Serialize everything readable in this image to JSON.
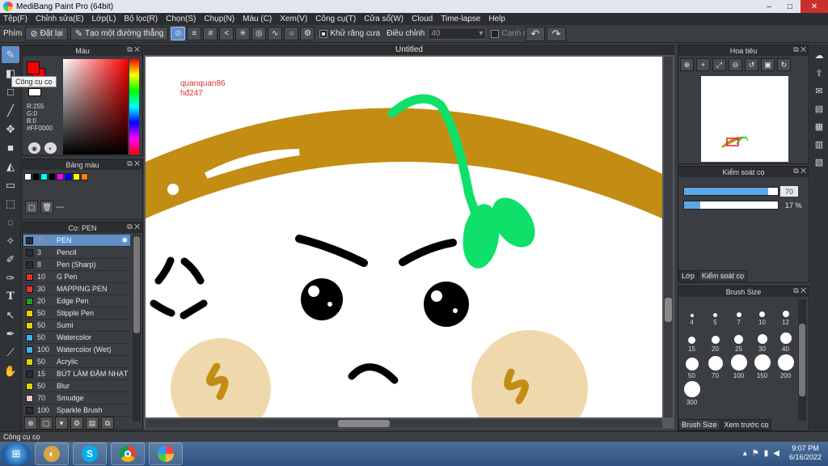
{
  "window": {
    "title": "MediBang Paint Pro (64bit)",
    "minimize": "–",
    "maximize": "□",
    "close": "✕"
  },
  "menu": [
    "Tệp(F)",
    "Chỉnh sửa(E)",
    "Lớp(L)",
    "Bộ lọc(R)",
    "Chọn(S)",
    "Chụp(N)",
    "Màu (C)",
    "Xem(V)",
    "Công cụ(T)",
    "Cửa sổ(W)",
    "Cloud",
    "Time-lapse",
    "Help"
  ],
  "options": {
    "label": "Phím",
    "reset": "Đặt lại",
    "straight_line": "Tạo một đường thẳng",
    "antialias": "Khử răng cưa",
    "adjust": "Điều chỉnh",
    "adjust_value": "40",
    "edge": "Cạnh mềm"
  },
  "tooltip": "Công cụ cọ",
  "color_panel": {
    "title": "Màu",
    "r": "R:255",
    "g": "G:0",
    "b": "B:0",
    "hex": "#FF0000"
  },
  "palette_panel": {
    "title": "Bảng màu",
    "colors": [
      "#ffffff",
      "#000000",
      "#00ffff",
      "#000000",
      "#ff00ff",
      "#0000ff",
      "#ffff00",
      "#ff8000"
    ],
    "dash": "---"
  },
  "brush_panel": {
    "title": "Cọ: PEN",
    "items": [
      {
        "color": "#2a2d33",
        "size": "70",
        "name": "PEN",
        "selected": true
      },
      {
        "color": "#2a2d33",
        "size": "3",
        "name": "Pencil"
      },
      {
        "color": "#2a2d33",
        "size": "8",
        "name": "Pen (Sharp)"
      },
      {
        "color": "#e53030",
        "size": "10",
        "name": "G Pen"
      },
      {
        "color": "#e53030",
        "size": "30",
        "name": "MAPPING PEN"
      },
      {
        "color": "#1fa01f",
        "size": "20",
        "name": "Edge Pen"
      },
      {
        "color": "#e8d100",
        "size": "50",
        "name": "Stipple Pen"
      },
      {
        "color": "#e8d100",
        "size": "50",
        "name": "Sumi"
      },
      {
        "color": "#3fb3e8",
        "size": "50",
        "name": "Watercolor"
      },
      {
        "color": "#3fb3e8",
        "size": "100",
        "name": "Watercolor (Wet)"
      },
      {
        "color": "#e8d100",
        "size": "50",
        "name": "Acrylic"
      },
      {
        "color": "#2a2d33",
        "size": "15",
        "name": "BÚT LÀM ĐẬM NHẠT"
      },
      {
        "color": "#e8d100",
        "size": "50",
        "name": "Blur"
      },
      {
        "color": "#f3c9c0",
        "size": "70",
        "name": "Smudge"
      },
      {
        "color": "#2a2d33",
        "size": "100",
        "name": "Sparkle Brush"
      }
    ]
  },
  "canvas": {
    "tab_title": "Untitled",
    "signature_line1": "quanquan86",
    "signature_line2": "hđ247"
  },
  "navigator": {
    "title": "Hoa tiêu"
  },
  "brush_control": {
    "title": "Kiểm soát cọ",
    "size_value": "70",
    "size_fraction": 0.9,
    "opacity_value": "17 %",
    "opacity_fraction": 0.17,
    "tab_layer": "Lớp",
    "tab_control": "Kiểm soát cọ"
  },
  "brush_size": {
    "title": "Brush Size",
    "sizes": [
      "4",
      "5",
      "7",
      "10",
      "12",
      "15",
      "20",
      "25",
      "30",
      "40",
      "50",
      "70",
      "100",
      "150",
      "200",
      "300"
    ],
    "tab_size": "Brush Size",
    "tab_preview": "Xem trước cọ"
  },
  "status": "Công cụ cọ",
  "taskbar": {
    "time": "9:07 PM",
    "date": "6/16/2022"
  }
}
